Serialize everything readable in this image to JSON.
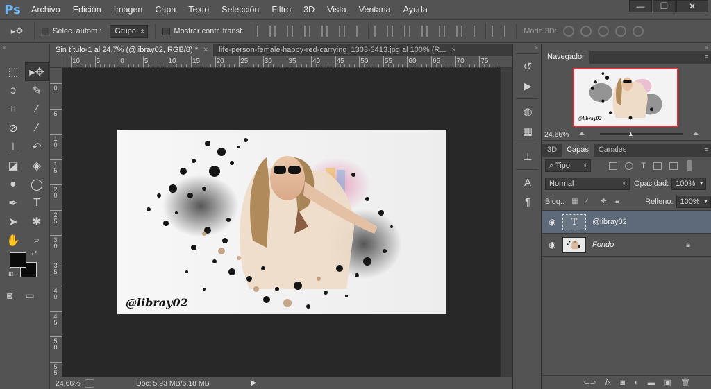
{
  "app": {
    "logo": "Ps"
  },
  "menu": [
    "Archivo",
    "Edición",
    "Imagen",
    "Capa",
    "Texto",
    "Selección",
    "Filtro",
    "3D",
    "Vista",
    "Ventana",
    "Ayuda"
  ],
  "window_controls": {
    "minimize": "—",
    "restore": "❐",
    "close": "✕"
  },
  "options": {
    "auto_select_label": "Selec. autom.:",
    "auto_select_value": "Grupo",
    "show_transform_label": "Mostrar contr. transf.",
    "mode3d_label": "Modo 3D:"
  },
  "tabs": [
    {
      "label": "Sin título-1 al 24,7% (@libray02, RGB/8) *",
      "active": true
    },
    {
      "label": "life-person-female-happy-red-carrying_1303-3413.jpg al 100% (R...",
      "active": false
    }
  ],
  "ruler_h": [
    "10",
    "5",
    "0",
    "5",
    "10",
    "15",
    "20",
    "25",
    "30",
    "35",
    "40",
    "45",
    "50",
    "55",
    "60",
    "65",
    "70",
    "75"
  ],
  "ruler_v": [
    "0",
    "5",
    "1 0",
    "1 5",
    "2 0",
    "2 5",
    "3 0",
    "3 5",
    "4 0",
    "4 5",
    "5 0",
    "5 5"
  ],
  "canvas": {
    "watermark_text": "@libray02"
  },
  "status": {
    "zoom": "24,66%",
    "doc_info": "Doc: 5,93 MB/6,18 MB"
  },
  "navigator": {
    "tab_label": "Navegador",
    "zoom_value": "24,66%",
    "thumb_text": "@libray02"
  },
  "layers_panel": {
    "tabs": [
      "3D",
      "Capas",
      "Canales"
    ],
    "active_tab": "Capas",
    "filter_label": "Tipo",
    "blend_mode": "Normal",
    "opacity_label": "Opacidad:",
    "opacity_value": "100%",
    "lock_label": "Bloq.:",
    "fill_label": "Relleno:",
    "fill_value": "100%",
    "layers": [
      {
        "name": "@libray02",
        "type": "text",
        "selected": true,
        "locked": false
      },
      {
        "name": "Fondo",
        "type": "image",
        "selected": false,
        "locked": true
      }
    ]
  },
  "icons": {
    "move_tool": "move-tool-icon",
    "eye": "eye-icon",
    "lock": "lock-icon"
  }
}
